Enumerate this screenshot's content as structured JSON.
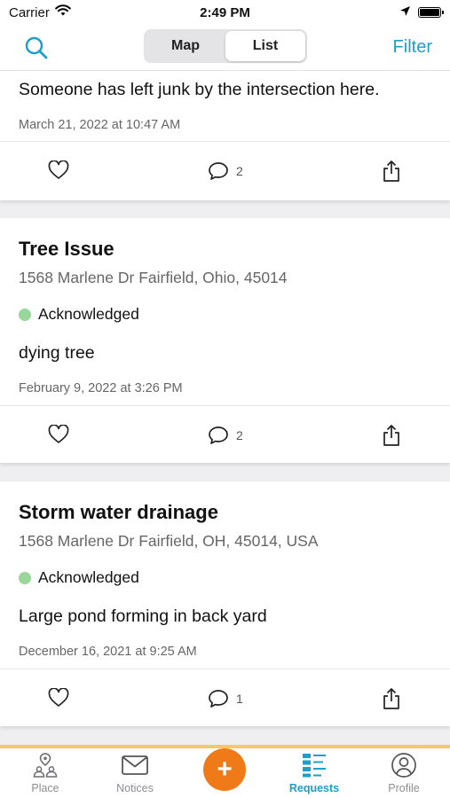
{
  "status_bar": {
    "carrier": "Carrier",
    "time": "2:49 PM"
  },
  "nav": {
    "segments": [
      "Map",
      "List"
    ],
    "active_segment": "List",
    "filter_label": "Filter",
    "accent_color": "#1e9fc9"
  },
  "requests": [
    {
      "title": "",
      "address": "",
      "status": "",
      "description": "Someone has left junk by the intersection here.",
      "date": "March 21, 2022 at 10:47 AM",
      "comments": "2"
    },
    {
      "title": "Tree Issue",
      "address": "1568 Marlene Dr Fairfield, Ohio, 45014",
      "status": "Acknowledged",
      "description": "dying tree",
      "date": "February 9, 2022 at 3:26 PM",
      "comments": "2"
    },
    {
      "title": "Storm water drainage",
      "address": "1568 Marlene Dr Fairfield, OH, 45014, USA",
      "status": "Acknowledged",
      "description": "Large pond forming in back yard",
      "date": "December 16, 2021 at 9:25 AM",
      "comments": "1"
    }
  ],
  "status_color": "#97d79a",
  "tab_bar": {
    "tabs": [
      {
        "label": "Place",
        "icon": "place-icon"
      },
      {
        "label": "Notices",
        "icon": "mail-icon"
      },
      {
        "label": "",
        "icon": "plus-icon"
      },
      {
        "label": "Requests",
        "icon": "requests-list-icon"
      },
      {
        "label": "Profile",
        "icon": "profile-icon"
      }
    ],
    "active_tab": "Requests",
    "fab_color": "#f07a17",
    "top_border_color": "#f7c964"
  }
}
